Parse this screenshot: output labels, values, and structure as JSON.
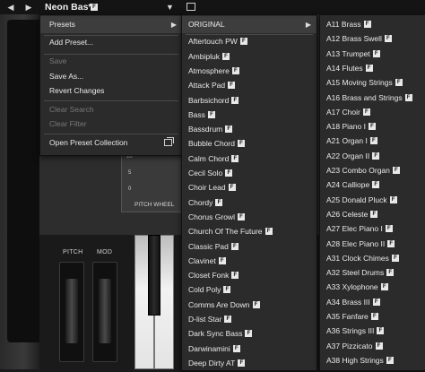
{
  "topbar": {
    "prev_icon": "◀",
    "next_icon": "▶",
    "preset_name": "Neon Bas*",
    "badge": "F",
    "caret": "▼"
  },
  "instrument": {
    "pitch_label": "PITCH",
    "mod_label": "MOD",
    "pitch_wheel_label": "PITCH WHEEL",
    "pw_ticks": [
      "10",
      "5",
      "0"
    ]
  },
  "main_menu": {
    "items": [
      {
        "label": "Presets",
        "disabled": false,
        "submenu": true
      },
      {
        "label": "Add Preset...",
        "disabled": false
      },
      {
        "label": "Save",
        "disabled": true
      },
      {
        "label": "Save As...",
        "disabled": false
      },
      {
        "label": "Revert Changes",
        "disabled": false
      },
      {
        "label": "Clear Search",
        "disabled": true
      },
      {
        "label": "Clear Filter",
        "disabled": true
      },
      {
        "label": "Open Preset Collection",
        "disabled": false,
        "window_icon": true
      }
    ]
  },
  "presets_menu": {
    "items": [
      {
        "label": "ORIGINAL",
        "submenu": true
      },
      {
        "label": "Aftertouch PW",
        "badge": "F"
      },
      {
        "label": "Ambipluk",
        "badge": "F"
      },
      {
        "label": "Atmosphere",
        "badge": "F"
      },
      {
        "label": "Attack Pad",
        "badge": "F"
      },
      {
        "label": "Barbsichord",
        "badge": "F"
      },
      {
        "label": "Bass",
        "badge": "F"
      },
      {
        "label": "Bassdrum",
        "badge": "F"
      },
      {
        "label": "Bubble Chord",
        "badge": "F"
      },
      {
        "label": "Calm Chord",
        "badge": "F"
      },
      {
        "label": "Cecil Solo",
        "badge": "F"
      },
      {
        "label": "Choir Lead",
        "badge": "F"
      },
      {
        "label": "Chordy",
        "badge": "F"
      },
      {
        "label": "Chorus Growl",
        "badge": "F"
      },
      {
        "label": "Church Of The Future",
        "badge": "F"
      },
      {
        "label": "Classic Pad",
        "badge": "F"
      },
      {
        "label": "Clavinet",
        "badge": "F"
      },
      {
        "label": "Closet Fonk",
        "badge": "F"
      },
      {
        "label": "Cold Poly",
        "badge": "F"
      },
      {
        "label": "Comms Are Down",
        "badge": "F"
      },
      {
        "label": "D-list Star",
        "badge": "F"
      },
      {
        "label": "Dark Sync Bass",
        "badge": "F"
      },
      {
        "label": "Darwinamini",
        "badge": "F"
      },
      {
        "label": "Deep Dirty AT",
        "badge": "F"
      }
    ]
  },
  "original_menu": {
    "items": [
      {
        "label": "A11 Brass",
        "badge": "F"
      },
      {
        "label": "A12 Brass Swell",
        "badge": "F"
      },
      {
        "label": "A13 Trumpet",
        "badge": "F"
      },
      {
        "label": "A14 Flutes",
        "badge": "F"
      },
      {
        "label": "A15 Moving Strings",
        "badge": "F"
      },
      {
        "label": "A16 Brass and Strings",
        "badge": "F"
      },
      {
        "label": "A17 Choir",
        "badge": "F"
      },
      {
        "label": "A18 Piano I",
        "badge": "F"
      },
      {
        "label": "A21 Organ I",
        "badge": "F"
      },
      {
        "label": "A22 Organ II",
        "badge": "F"
      },
      {
        "label": "A23 Combo Organ",
        "badge": "F"
      },
      {
        "label": "A24 Calliope",
        "badge": "F"
      },
      {
        "label": "A25 Donald Pluck",
        "badge": "F"
      },
      {
        "label": "A26 Celeste",
        "badge": "F"
      },
      {
        "label": "A27 Elec Piano I",
        "badge": "F"
      },
      {
        "label": "A28 Elec Piano II",
        "badge": "F"
      },
      {
        "label": "A31 Clock Chimes",
        "badge": "F"
      },
      {
        "label": "A32 Steel Drums",
        "badge": "F"
      },
      {
        "label": "A33 Xylophone",
        "badge": "F"
      },
      {
        "label": "A34 Brass III",
        "badge": "F"
      },
      {
        "label": "A35 Fanfare",
        "badge": "F"
      },
      {
        "label": "A36 Strings III",
        "badge": "F"
      },
      {
        "label": "A37 Pizzicato",
        "badge": "F"
      },
      {
        "label": "A38 High Strings",
        "badge": "F"
      }
    ]
  }
}
